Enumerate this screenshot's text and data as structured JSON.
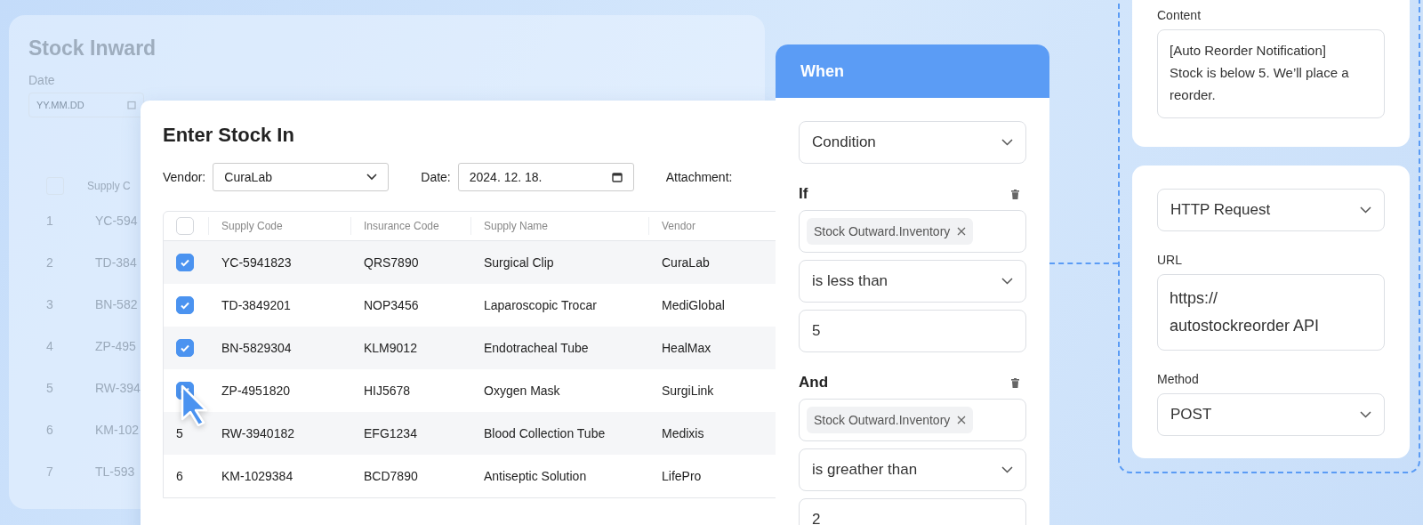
{
  "background_panel": {
    "title": "Stock Inward",
    "date_label": "Date",
    "date_placeholder": "YY.MM.DD",
    "column_2": "Supply C",
    "header_checked": false,
    "rows": [
      {
        "number": "1",
        "code": "YC-594"
      },
      {
        "number": "2",
        "code": "TD-384"
      },
      {
        "number": "3",
        "code": "BN-582"
      },
      {
        "number": "4",
        "code": "ZP-495"
      },
      {
        "number": "5",
        "code": "RW-394"
      },
      {
        "number": "6",
        "code": "KM-102"
      },
      {
        "number": "7",
        "code": "TL-593"
      }
    ]
  },
  "dialog": {
    "title": "Enter Stock In",
    "vendor_label": "Vendor:",
    "vendor": "CuraLab",
    "date_label": "Date:",
    "date": "2024. 12. 18.",
    "attachment_label": "Attachment:",
    "header_checked": false,
    "columns": [
      "Supply Code",
      "Insurance Code",
      "Supply Name",
      "Vendor"
    ],
    "rows": [
      {
        "kind": "checkbox",
        "checked": true,
        "cells": [
          "YC-5941823",
          "QRS7890",
          "Surgical Clip",
          "CuraLab"
        ]
      },
      {
        "kind": "checkbox",
        "checked": true,
        "cells": [
          "TD-3849201",
          "NOP3456",
          "Laparoscopic Trocar",
          "MediGlobal"
        ]
      },
      {
        "kind": "checkbox",
        "checked": true,
        "cells": [
          "BN-5829304",
          "KLM9012",
          "Endotracheal Tube",
          "HealMax"
        ]
      },
      {
        "kind": "checkbox",
        "checked": true,
        "cells": [
          "ZP-4951820",
          "HIJ5678",
          "Oxygen Mask",
          "SurgiLink"
        ]
      },
      {
        "kind": "number",
        "number": "5",
        "cells": [
          "RW-3940182",
          "EFG1234",
          "Blood Collection Tube",
          "Medixis"
        ]
      },
      {
        "kind": "number",
        "number": "6",
        "cells": [
          "KM-1029384",
          "BCD7890",
          "Antiseptic Solution",
          "LifePro"
        ]
      }
    ]
  },
  "when_card": {
    "title": "When",
    "type": "Condition",
    "conditions": [
      {
        "label": "If",
        "field": "Stock Outward.Inventory",
        "operator": "is less than",
        "value": "5"
      },
      {
        "label": "And",
        "field": "Stock Outward.Inventory",
        "operator": "is greather than",
        "value": "2"
      }
    ]
  },
  "action_panel": {
    "content_label": "Content",
    "content": "[Auto Reorder Notification] Stock is below 5. We’ll place a reorder.",
    "action": "HTTP Request",
    "url_label": "URL",
    "url": "https:// autostockreorder API",
    "method_label": "Method",
    "method": "POST"
  }
}
